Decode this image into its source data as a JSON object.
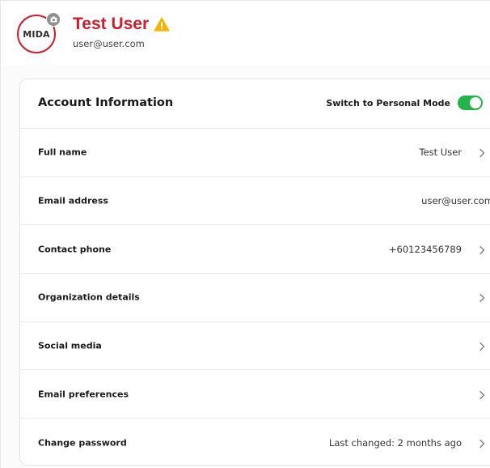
{
  "profile": {
    "avatar_text": "MIDA",
    "name": "Test User",
    "email": "user@user.com"
  },
  "card": {
    "title": "Account Information",
    "mode_switch_label": "Switch to Personal Mode",
    "mode_switch_on": true
  },
  "rows": [
    {
      "label": "Full name",
      "value": "Test User"
    },
    {
      "label": "Email address",
      "value": "user@user.com"
    },
    {
      "label": "Contact phone",
      "value": "+60123456789"
    },
    {
      "label": "Organization details",
      "value": ""
    },
    {
      "label": "Social media",
      "value": ""
    },
    {
      "label": "Email preferences",
      "value": ""
    },
    {
      "label": "Change password",
      "value": "Last changed: 2 months ago"
    }
  ],
  "colors": {
    "brand_red": "#c8202f",
    "toggle_green": "#24b24b",
    "warning_yellow": "#f5b400"
  },
  "icons": {
    "camera": "camera-icon",
    "warning": "warning-icon",
    "chevron": "chevron-right-icon"
  }
}
